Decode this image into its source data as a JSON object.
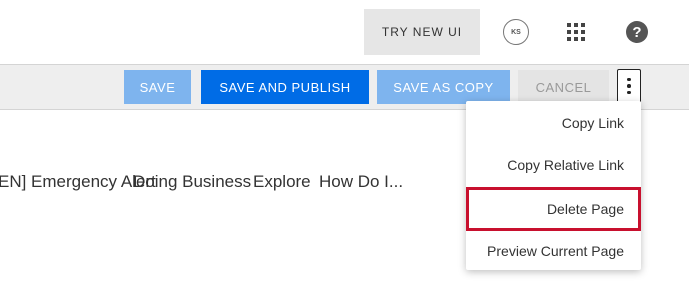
{
  "header": {
    "try_new_ui_label": "TRY NEW UI",
    "avatar_initials": "KS",
    "apps_icon": "grid-apps-icon",
    "help_icon": "question-circle-icon",
    "help_glyph": "?"
  },
  "toolbar": {
    "save_label": "SAVE",
    "save_and_publish_label": "SAVE AND PUBLISH",
    "save_as_copy_label": "SAVE AS COPY",
    "cancel_label": "CANCEL",
    "more_icon": "vertical-dots-icon"
  },
  "nav": {
    "items": [
      "EN] Emergency Alert",
      "Doing Business",
      "Explore",
      "How Do I..."
    ]
  },
  "menu": {
    "items": [
      "Copy Link",
      "Copy Relative Link",
      "Delete Page",
      "Preview Current Page"
    ],
    "highlighted_item": "Delete Page"
  },
  "colors": {
    "primary_blue": "#006ce6",
    "light_blue": "#7eb4ee",
    "highlight_red": "#c8102e",
    "toolbar_bg": "#eeeeee"
  }
}
